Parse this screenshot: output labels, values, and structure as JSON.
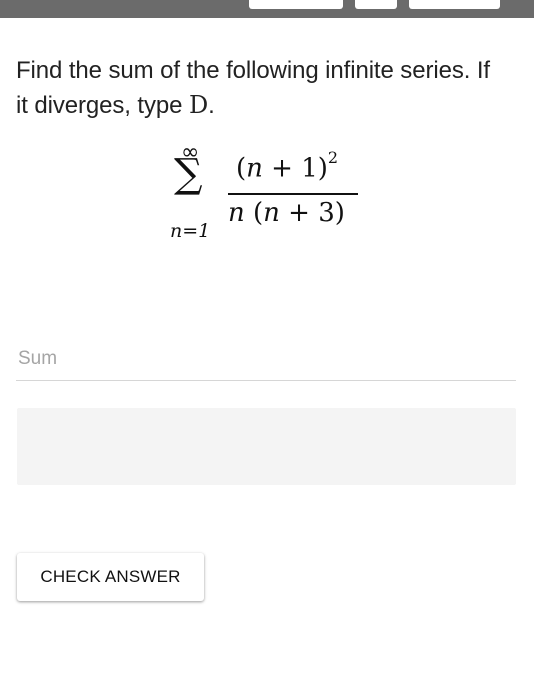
{
  "question": {
    "text": "Find the sum of the following infinite series. If it diverges, type",
    "diverge_symbol": "D",
    "end_punct": "."
  },
  "formula": {
    "sum_upper": "∞",
    "sum_symbol": "∑",
    "sum_lower": "n=1",
    "numerator_var": "n",
    "numerator_rest": " + 1)",
    "numerator_open": "(",
    "numerator_exp": "2",
    "denominator_var": "n",
    "denominator_open": " (",
    "denominator_var2": "n",
    "denominator_rest": " + 3)"
  },
  "answer": {
    "placeholder": "Sum",
    "value": ""
  },
  "actions": {
    "check_label": "CHECK ANSWER"
  }
}
